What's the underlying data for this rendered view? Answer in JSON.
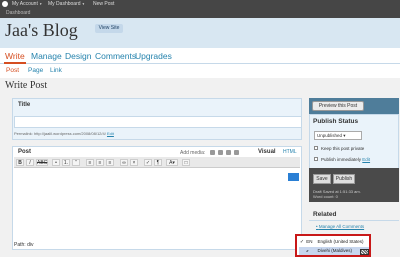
{
  "admin_bar": {
    "links": [
      "My Account",
      "My Dashboard",
      "New Post"
    ],
    "dashboard_label": "Dashboard"
  },
  "header": {
    "blog_title": "Jaa's Blog",
    "view_site": "View Site"
  },
  "main_nav": [
    "Write",
    "Manage",
    "Design",
    "Comments",
    "Upgrades"
  ],
  "sub_nav": [
    "Post",
    "Page",
    "Link"
  ],
  "page_title": "Write Post",
  "title_panel": {
    "label": "Title",
    "value": "",
    "permalink_label": "Permalink:",
    "permalink_url": "http://jaalil.wordpress.com/2008/08/12/4/",
    "edit_label": "Edit"
  },
  "editor": {
    "label": "Post",
    "add_media": "Add media:",
    "tab_visual": "Visual",
    "tab_html": "HTML",
    "toolbar_buttons": [
      "B",
      "I",
      "ABC",
      "•",
      "1.",
      "“",
      "≡",
      "≡",
      "≡",
      "∞",
      "×",
      "✓",
      "¶",
      "A▾",
      "□"
    ],
    "path": "Path: div",
    "content": ""
  },
  "sidebar": {
    "preview_button": "Preview this Post",
    "publish_status_title": "Publish Status",
    "status_value": "Unpublished",
    "keep_private": "Keep this post private",
    "publish_immediately": "Publish immediately",
    "publish_immediately_edit": "Edit",
    "save_button": "Save",
    "publish_button": "Publish",
    "draft_saved": "Draft Saved at 1:51:33 am.",
    "word_count": "Word count: 0",
    "related_title": "Related",
    "related_link": "Manage All Comments"
  },
  "language_menu": {
    "options": [
      {
        "code": "EN",
        "label": "English (United States)",
        "selected": true
      },
      {
        "code": "ޒ",
        "label": "Divehi (Maldives)",
        "selected": false
      }
    ]
  },
  "colors": {
    "link": "#2583ad",
    "active_nav": "#d54e21",
    "header_bg": "#d8e7f2",
    "highlight_box": "#c81818"
  }
}
